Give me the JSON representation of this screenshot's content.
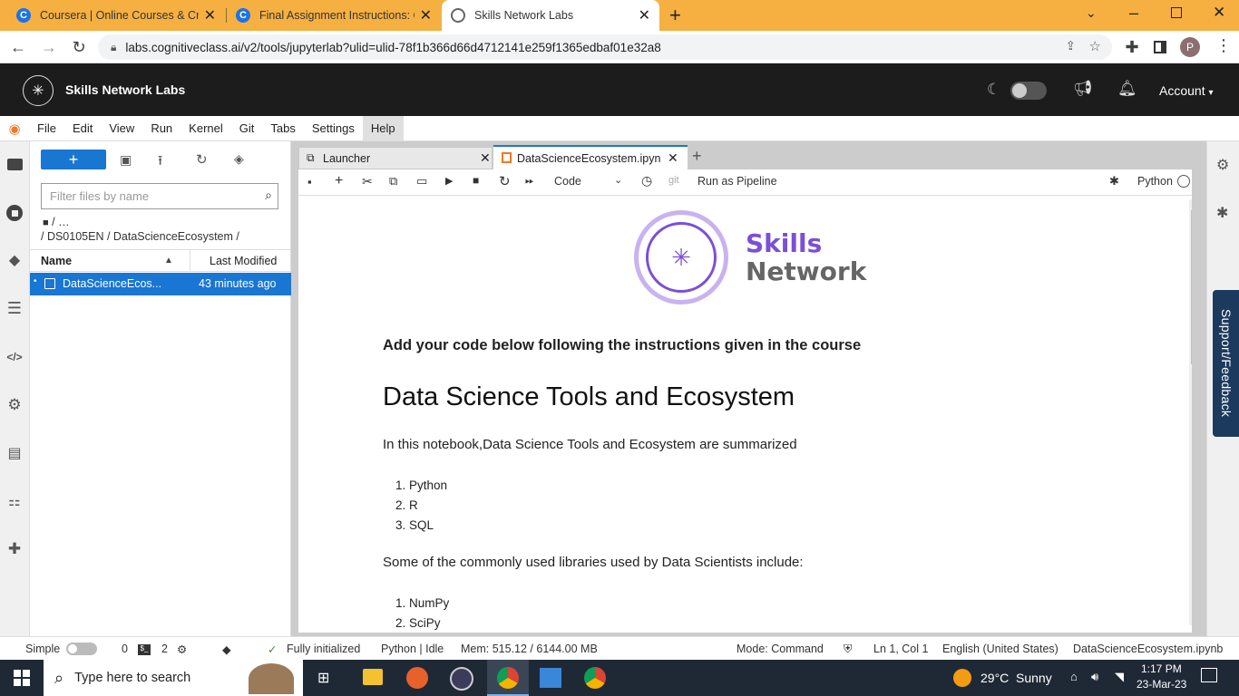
{
  "browser": {
    "tabs": [
      {
        "title": "Coursera | Online Courses & Cred",
        "icon": "coursera-icon"
      },
      {
        "title": "Final Assignment Instructions: Cr",
        "icon": "coursera-icon"
      },
      {
        "title": "Skills Network Labs",
        "icon": "globe-icon"
      }
    ],
    "new_tab": "+",
    "url": "labs.cognitiveclass.ai/v2/tools/jupyterlab?ulid=ulid-78f1b366d66d4712141e259f1365edbaf01e32a8",
    "profile_initial": "P"
  },
  "header": {
    "brand": "Skills Network Labs",
    "account": "Account"
  },
  "menu": [
    "File",
    "Edit",
    "View",
    "Run",
    "Kernel",
    "Git",
    "Tabs",
    "Settings",
    "Help"
  ],
  "filebrowser": {
    "new_button": "+",
    "filter_placeholder": "Filter files by name",
    "crumb_top": "/ …",
    "crumb_path": "/ DS0105EN / DataScienceEcosystem /",
    "col_name": "Name",
    "col_modified": "Last Modified",
    "files": [
      {
        "name": "DataScienceEcos...",
        "modified": "43 minutes ago",
        "selected": true
      }
    ]
  },
  "doc_tabs": [
    {
      "label": "Launcher",
      "active": false
    },
    {
      "label": "DataScienceEcosystem.ipyn",
      "active": true
    }
  ],
  "toolbar": {
    "cell_type": "Code",
    "git": "git",
    "run_pipeline": "Run as Pipeline",
    "kernel": "Python"
  },
  "notebook": {
    "logo_line1": "Skills",
    "logo_line2": "Network",
    "intro": "Add your code below following the instructions given in the course",
    "title": "Data Science Tools and Ecosystem",
    "summary": "In this notebook,Data Science Tools and Ecosystem are summarized",
    "languages": [
      "Python",
      "R",
      "SQL"
    ],
    "libraries_intro": "Some of the commonly used libraries used by Data Scientists include:",
    "libraries": [
      "NumPy",
      "SciPy"
    ]
  },
  "support_tab": "Support/Feedback",
  "status": {
    "simple": "Simple",
    "terminals": "0",
    "kernels": "2",
    "git_status": "Fully initialized",
    "kernel_status": "Python | Idle",
    "mem": "Mem: 515.12 / 6144.00 MB",
    "mode": "Mode: Command",
    "position": "Ln 1, Col 1",
    "language": "English (United States)",
    "filename": "DataScienceEcosystem.ipynb"
  },
  "taskbar": {
    "search_placeholder": "Type here to search",
    "weather_temp": "29°C",
    "weather_desc": "Sunny",
    "time": "1:17 PM",
    "date": "23-Mar-23"
  },
  "colors": {
    "tab_bar": "#f5b041",
    "accent": "#1a73e8",
    "brand_purple": "#7b4fd6",
    "header_bg": "#1c1c1c"
  }
}
